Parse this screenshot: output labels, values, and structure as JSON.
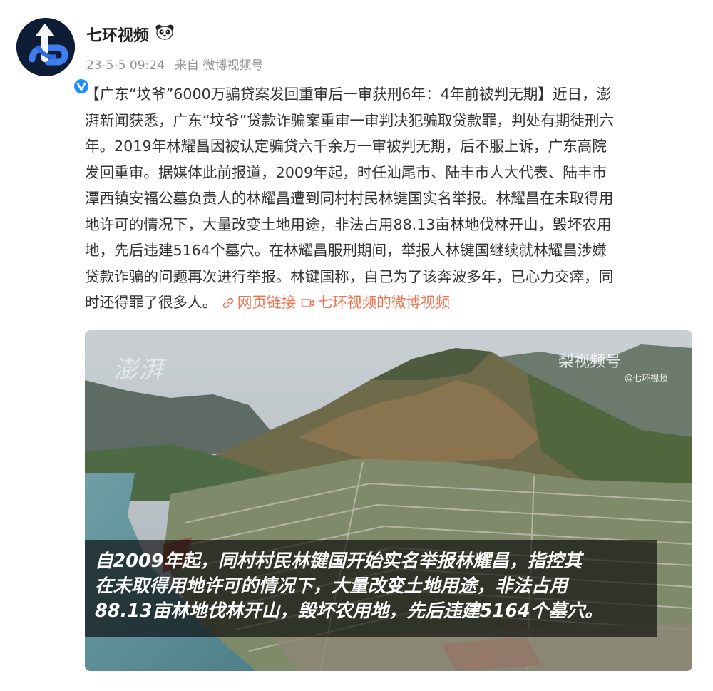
{
  "post": {
    "author": "七环视频",
    "timestamp": "23-5-5 09:24",
    "source": "来自 微博视频号",
    "text_lines": [
      "【广东“坟爷”6000万骗贷案发回重审后一审获刑6年：4年前被判无期】近日，澎",
      "湃新闻获悉，广东“坟爷”贷款诈骗案重审一审判决犯骗取贷款罪，判处有期徒刑六",
      "年。2019年林耀昌因被认定骗贷六千余万一审被判无期，后不服上诉，广东高院",
      "发回重审。据媒体此前报道，2009年起，时任汕尾市、陆丰市人大代表、陆丰市",
      "潭西镇安福公墓负责人的林耀昌遭到同村村民林键国实名举报。林耀昌在未取得用",
      "地许可的情况下，大量改变土地用途，非法占用88.13亩林地伐林开山，毁坏农用",
      "地，先后违建5164个墓穴。在林耀昌服刑期间，举报人林键国继续就林耀昌涉嫌",
      "贷款诈骗的问题再次进行举报。林键国称，自己为了该奔波多年，已心力交瘁，同"
    ],
    "text_last_line": "时还得罪了很多人。",
    "web_link_label": "网页链接",
    "video_link_label": "七环视频的微博视频",
    "link_color": "#eb7350"
  },
  "media": {
    "watermark_left": "澎湃",
    "watermark_right": "梨视频号",
    "watermark_handle": "@七环视频",
    "caption_lines": [
      "自2009年起，同村村民林键国开始实名举报林耀昌，指控其",
      "在未取得用地许可的情况下，大量改变土地用途，非法占用",
      "88.13亩林地伐林开山，毁坏农用地，先后违建5164个墓穴。"
    ]
  },
  "icons": {
    "avatar": "avatar-logo",
    "verified": "verified-badge-icon",
    "panda": "panda-emoji-icon",
    "link": "link-icon",
    "video": "video-icon"
  }
}
